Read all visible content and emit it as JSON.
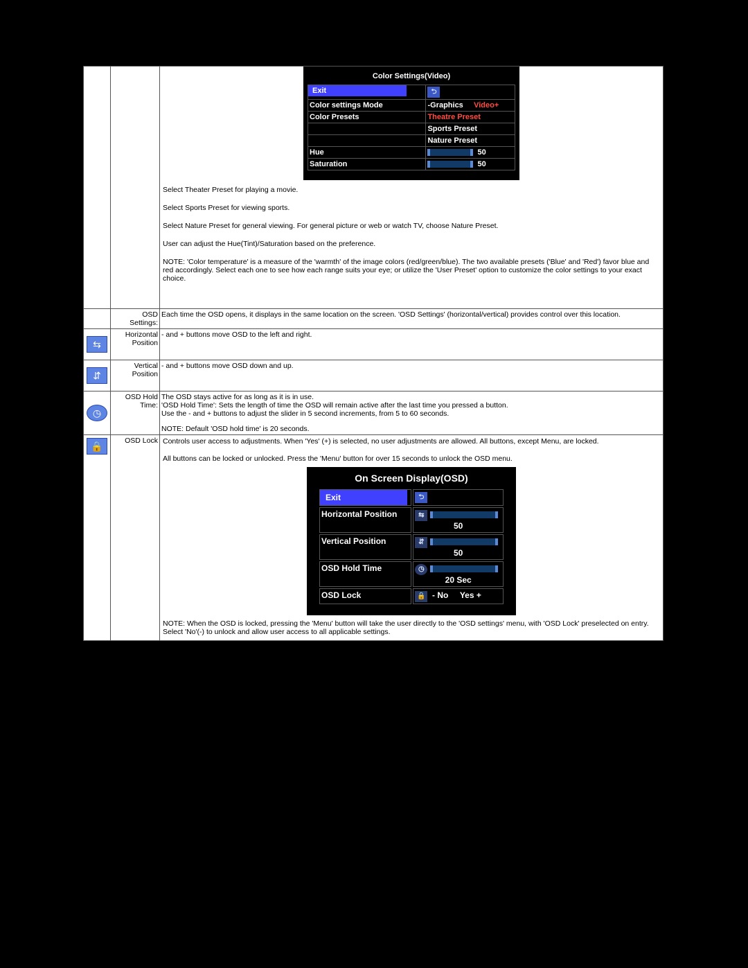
{
  "cs": {
    "title": "Color Settings(Video)",
    "exit": "Exit",
    "mode_label": "Color settings Mode",
    "mode_minus": "-Graphics",
    "mode_plus": "Video+",
    "presets_label": "Color Presets",
    "theatre": "Theatre Preset",
    "sports": "Sports Preset",
    "nature": "Nature Preset",
    "hue_label": "Hue",
    "hue_val": "50",
    "sat_label": "Saturation",
    "sat_val": "50"
  },
  "desc": {
    "theater": "Select Theater Preset for playing a movie.",
    "sports": "Select Sports Preset for viewing sports.",
    "nature": "Select Nature Preset for general viewing. For general picture or web or watch TV, choose Nature Preset.",
    "hue": "User can adjust the Hue(Tint)/Saturation based on the preference.",
    "temp": "NOTE: 'Color temperature' is a measure of the 'warmth' of the image colors (red/green/blue). The two available presets ('Blue' and 'Red') favor blue and red accordingly. Select each one to see how each range suits your eye; or utilize the 'User Preset' option to customize the color settings to your exact choice."
  },
  "rows": {
    "osd_label": "OSD Settings:",
    "osd_body": "Each time the OSD opens, it displays in the same location on the screen. 'OSD Settings' (horizontal/vertical) provides control over this location.",
    "hpos_label": "Horizontal Position",
    "hpos_body": "- and + buttons move OSD to the left and right.",
    "vpos_label": "Vertical Position",
    "vpos_body": "- and + buttons move OSD down and up.",
    "hold_label": "OSD Hold Time:",
    "hold_body1": "The OSD stays active for as long as it is in use.",
    "hold_body2": "'OSD Hold Time': Sets the length of time the OSD will remain active after the last time you pressed a button.",
    "hold_body3": "Use the - and + buttons to adjust the slider in 5 second increments, from 5 to 60 seconds.",
    "hold_note": "NOTE: Default 'OSD hold time' is 20 seconds.",
    "lock_label": "OSD Lock",
    "lock_body": "Controls user access to adjustments. When 'Yes' (+) is selected, no user adjustments are allowed. All buttons, except Menu, are locked.",
    "lock_all": "All buttons can be locked or unlocked. Press the 'Menu' button for over 15 seconds to unlock the OSD menu."
  },
  "osd2": {
    "title": "On Screen Display(OSD)",
    "exit": "Exit",
    "hpos": "Horizontal Position",
    "hval": "50",
    "vpos": "Vertical  Position",
    "vval": "50",
    "hold": "OSD Hold Time",
    "holdval": "20 Sec",
    "lock": "OSD Lock",
    "no": "- No",
    "yes": "Yes +",
    "footnote": "NOTE: When the OSD is locked, pressing the 'Menu' button will take the user directly to the 'OSD settings' menu, with 'OSD Lock' preselected on entry. Select 'No'(-) to unlock and allow user access to all applicable settings."
  }
}
